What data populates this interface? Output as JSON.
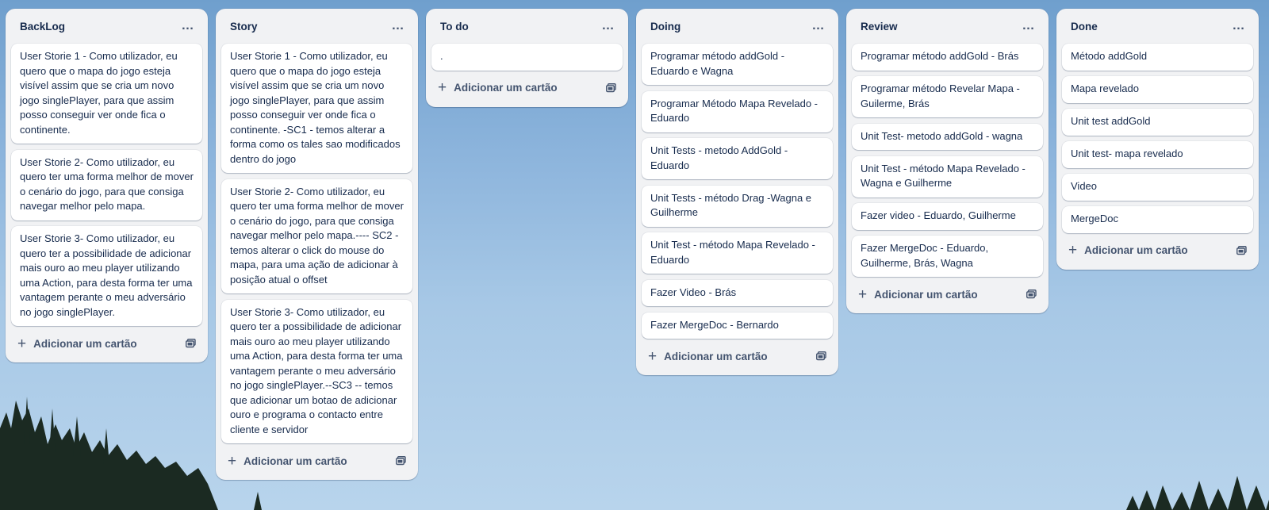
{
  "board": {
    "add_card_label": "Adicionar um cartão",
    "more_icon": "…",
    "lists": [
      {
        "title": "BackLog",
        "cards": [
          "User Storie 1 - Como utilizador, eu quero que o mapa do jogo esteja visível assim que se cria um novo jogo singlePlayer, para que assim posso conseguir ver onde fica o continente.",
          "User Storie 2- Como utilizador, eu quero ter uma forma melhor de mover o cenário do jogo, para que consiga navegar melhor pelo mapa.",
          "User Storie 3- Como utilizador, eu quero ter a possibilidade de adicionar mais ouro ao meu player utilizando uma Action, para desta forma ter uma vantagem perante o meu adversário no jogo singlePlayer."
        ]
      },
      {
        "title": "Story",
        "cards": [
          "User Storie 1 - Como utilizador, eu quero que o mapa do jogo esteja visível assim que se cria um novo jogo singlePlayer, para que assim posso conseguir ver onde fica o continente. -SC1 - temos alterar a forma como os tales sao modificados dentro do jogo",
          "User Storie 2- Como utilizador, eu quero ter uma forma melhor de mover o cenário do jogo, para que consiga navegar melhor pelo mapa.---- SC2 - temos alterar o click do mouse do mapa, para uma ação de adicionar à posição atual o offset",
          "User Storie 3- Como utilizador, eu quero ter a possibilidade de adicionar mais ouro ao meu player utilizando uma Action, para desta forma ter uma vantagem perante o meu adversário no jogo singlePlayer.--SC3 -- temos que adicionar um botao de adicionar ouro e programa o contacto entre cliente e servidor"
        ]
      },
      {
        "title": "To do",
        "cards": [
          "."
        ]
      },
      {
        "title": "Doing",
        "cards": [
          "Programar método addGold - Eduardo e Wagna",
          "Programar Método Mapa Revelado - Eduardo",
          "Unit Tests - metodo AddGold - Eduardo",
          "Unit Tests - método Drag -Wagna e Guilherme",
          "Unit Test - método Mapa Revelado - Eduardo",
          "Fazer Video - Brás",
          "Fazer MergeDoc - Bernardo"
        ]
      },
      {
        "title": "Review",
        "cards": [
          "Programar método addGold - Brás",
          "Programar método Revelar Mapa - Guilerme, Brás",
          "Unit Test- metodo addGold - wagna",
          "Unit Test - método Mapa Revelado - Wagna e Guilherme",
          "Fazer video - Eduardo, Guilherme",
          "Fazer MergeDoc - Eduardo, Guilherme, Brás, Wagna"
        ]
      },
      {
        "title": "Done",
        "cards": [
          "Método addGold",
          "Mapa revelado",
          "Unit test addGold",
          "Unit test- mapa revelado",
          "Video",
          "MergeDoc"
        ]
      }
    ]
  },
  "colors": {
    "list_bg": "#f1f2f4",
    "card_bg": "#ffffff",
    "text": "#172b4d",
    "muted_text": "#44546f",
    "sky": "#8cb4dc",
    "trees": "#1b2a22"
  },
  "icons": {
    "list_menu": "more-horizontal-icon",
    "add_card": "plus-icon",
    "create_from_template": "card-template-icon"
  }
}
